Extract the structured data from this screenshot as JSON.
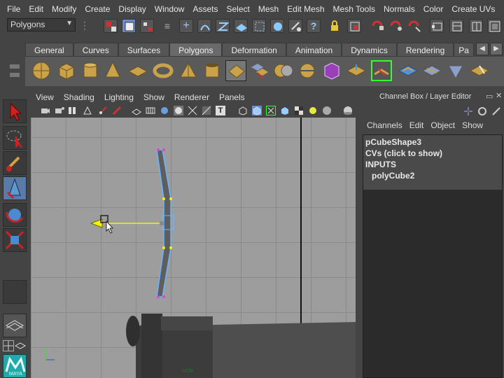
{
  "menubar": {
    "items": [
      "File",
      "Edit",
      "Modify",
      "Create",
      "Display",
      "Window",
      "Assets",
      "Select",
      "Mesh",
      "Edit Mesh",
      "Mesh Tools",
      "Normals",
      "Color",
      "Create UVs"
    ]
  },
  "status_line": {
    "mode_value": "Polygons"
  },
  "shelf": {
    "tabs": [
      "General",
      "Curves",
      "Surfaces",
      "Polygons",
      "Deformation",
      "Animation",
      "Dynamics",
      "Rendering",
      "Pa"
    ],
    "active_tab": "Polygons"
  },
  "panel": {
    "menu": [
      "View",
      "Shading",
      "Lighting",
      "Show",
      "Renderer",
      "Panels"
    ],
    "camera_label": "side"
  },
  "channel_box": {
    "title": "Channel Box / Layer Editor",
    "menu": [
      "Channels",
      "Edit",
      "Object",
      "Show"
    ],
    "shape_name": "pCubeShape3",
    "cvs_label": "CVs (click to show)",
    "inputs_label": "INPUTS",
    "input_node": "polyCube2"
  },
  "toolbox": {
    "logo_text": "MAYA"
  },
  "colors": {
    "accent_selection": "#6ab7ff",
    "manipulator_yellow": "#f5f500",
    "viewport_bg": "#9d9d9d"
  }
}
